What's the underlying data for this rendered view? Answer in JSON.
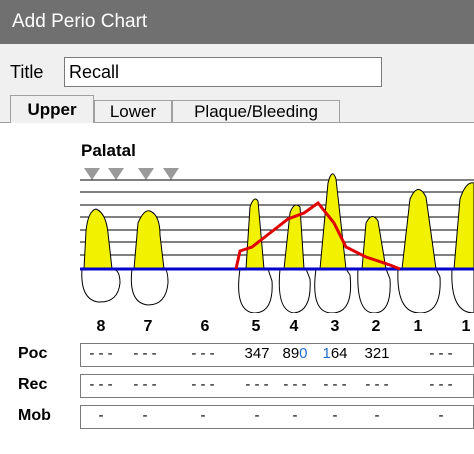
{
  "window": {
    "title": "Add Perio Chart"
  },
  "form": {
    "title_label": "Title",
    "title_value": "Recall"
  },
  "tabs": [
    {
      "label": "Upper",
      "active": true
    },
    {
      "label": "Lower",
      "active": false
    },
    {
      "label": "Plaque/Bleeding",
      "active": false
    }
  ],
  "chart": {
    "surface_label": "Palatal",
    "tooth_numbers": [
      "8",
      "7",
      "6",
      "5",
      "4",
      "3",
      "2",
      "1",
      "1"
    ],
    "colors": {
      "gum_line": "#0000cc",
      "pocket_line": "#e00000",
      "tooth_fill": "#f2f200",
      "marker": "#9a9a9a"
    }
  },
  "rows": {
    "poc": {
      "label": "Poc",
      "values": [
        "- - -",
        "- - -",
        "- - -",
        "347",
        "890",
        "164",
        "321",
        "- - -"
      ],
      "highlight": {
        "cell_4_char_3": "0",
        "cell_5_char_1": "1",
        "highlight_color": "#1e6fd0"
      }
    },
    "rec": {
      "label": "Rec",
      "values": [
        "- - -",
        "- - -",
        "- - -",
        "- - -",
        "- - -",
        "- - -",
        "- - -",
        "- - -"
      ]
    },
    "mob": {
      "label": "Mob",
      "values": [
        "-",
        "-",
        "-",
        "-",
        "-",
        "-",
        "-",
        "-"
      ]
    }
  }
}
